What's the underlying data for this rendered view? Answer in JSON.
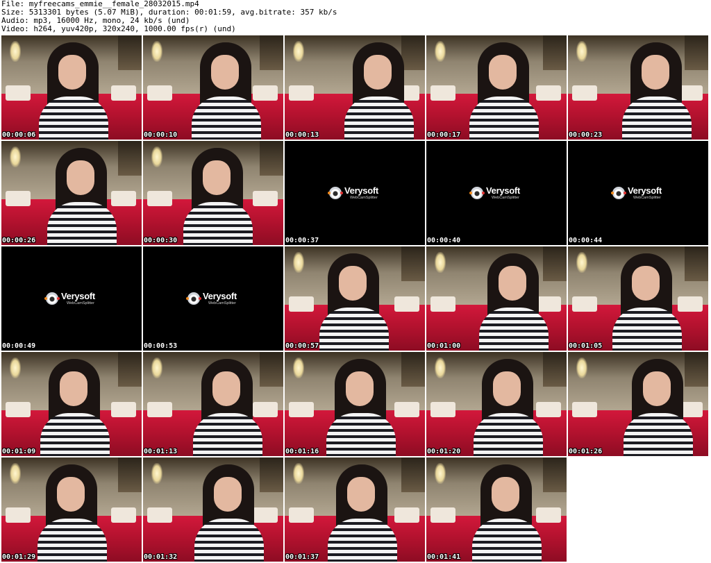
{
  "header": {
    "file_line": "File: myfreecams_emmie__female_28032015.mp4",
    "size_line": "Size: 5313301 bytes (5.07 MiB), duration: 00:01:59, avg.bitrate: 357 kb/s",
    "audio_line": "Audio: mp3, 16000 Hz, mono, 24 kb/s (und)",
    "video_line": "Video: h264, yuv420p, 320x240, 1000.00 fps(r) (und)"
  },
  "splash": {
    "brand": "Verysoft",
    "product": "WebCamSplitter"
  },
  "thumbnails": [
    {
      "time": "00:00:06",
      "kind": "webcam"
    },
    {
      "time": "00:00:10",
      "kind": "webcam"
    },
    {
      "time": "00:00:13",
      "kind": "webcam"
    },
    {
      "time": "00:00:17",
      "kind": "webcam"
    },
    {
      "time": "00:00:23",
      "kind": "webcam"
    },
    {
      "time": "00:00:26",
      "kind": "webcam"
    },
    {
      "time": "00:00:30",
      "kind": "webcam"
    },
    {
      "time": "00:00:37",
      "kind": "splash"
    },
    {
      "time": "00:00:40",
      "kind": "splash"
    },
    {
      "time": "00:00:44",
      "kind": "splash"
    },
    {
      "time": "00:00:49",
      "kind": "splash"
    },
    {
      "time": "00:00:53",
      "kind": "splash"
    },
    {
      "time": "00:00:57",
      "kind": "webcam"
    },
    {
      "time": "00:01:00",
      "kind": "webcam"
    },
    {
      "time": "00:01:05",
      "kind": "webcam"
    },
    {
      "time": "00:01:09",
      "kind": "webcam"
    },
    {
      "time": "00:01:13",
      "kind": "webcam"
    },
    {
      "time": "00:01:16",
      "kind": "webcam"
    },
    {
      "time": "00:01:20",
      "kind": "webcam"
    },
    {
      "time": "00:01:26",
      "kind": "webcam"
    },
    {
      "time": "00:01:29",
      "kind": "webcam"
    },
    {
      "time": "00:01:32",
      "kind": "webcam"
    },
    {
      "time": "00:01:37",
      "kind": "webcam"
    },
    {
      "time": "00:01:41",
      "kind": "webcam"
    }
  ]
}
